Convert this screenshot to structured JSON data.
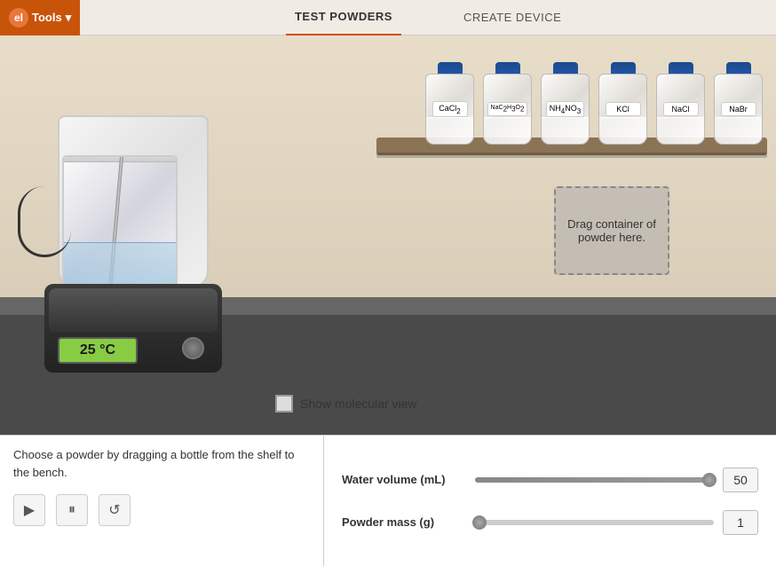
{
  "header": {
    "tools_label": "Tools",
    "logo_text": "el",
    "tabs": [
      {
        "id": "test-powders",
        "label": "TEST POWDERS",
        "active": true
      },
      {
        "id": "create-device",
        "label": "CREATE DEVICE",
        "active": false
      }
    ]
  },
  "scene": {
    "temperature": "25 °C",
    "molecular_view_label": "Show molecular view",
    "drag_zone_text": "Drag container of powder here.",
    "bottles": [
      {
        "id": "cacl2",
        "label": "CaCl₂",
        "label_raw": "CaCl2"
      },
      {
        "id": "nac2h3o2",
        "label": "NaC₂H₃O₂",
        "label_raw": "NaC2H3O2"
      },
      {
        "id": "nh4no3",
        "label": "NH₄NO₃",
        "label_raw": "NH4NO3"
      },
      {
        "id": "kcl",
        "label": "KCl",
        "label_raw": "KCl"
      },
      {
        "id": "nacl",
        "label": "NaCl",
        "label_raw": "NaCl"
      },
      {
        "id": "nabr",
        "label": "NaBr",
        "label_raw": "NaBr"
      }
    ]
  },
  "bottom": {
    "instruction": "Choose a powder by dragging a bottle from the shelf to the bench.",
    "play_icon": "▶",
    "pause_icon": "⏸",
    "reset_icon": "↺",
    "sliders": [
      {
        "id": "water-volume",
        "label": "Water volume (mL)",
        "value": 50,
        "fill_percent": 98
      },
      {
        "id": "powder-mass",
        "label": "Powder mass (g)",
        "value": 1,
        "fill_percent": 2
      }
    ]
  }
}
